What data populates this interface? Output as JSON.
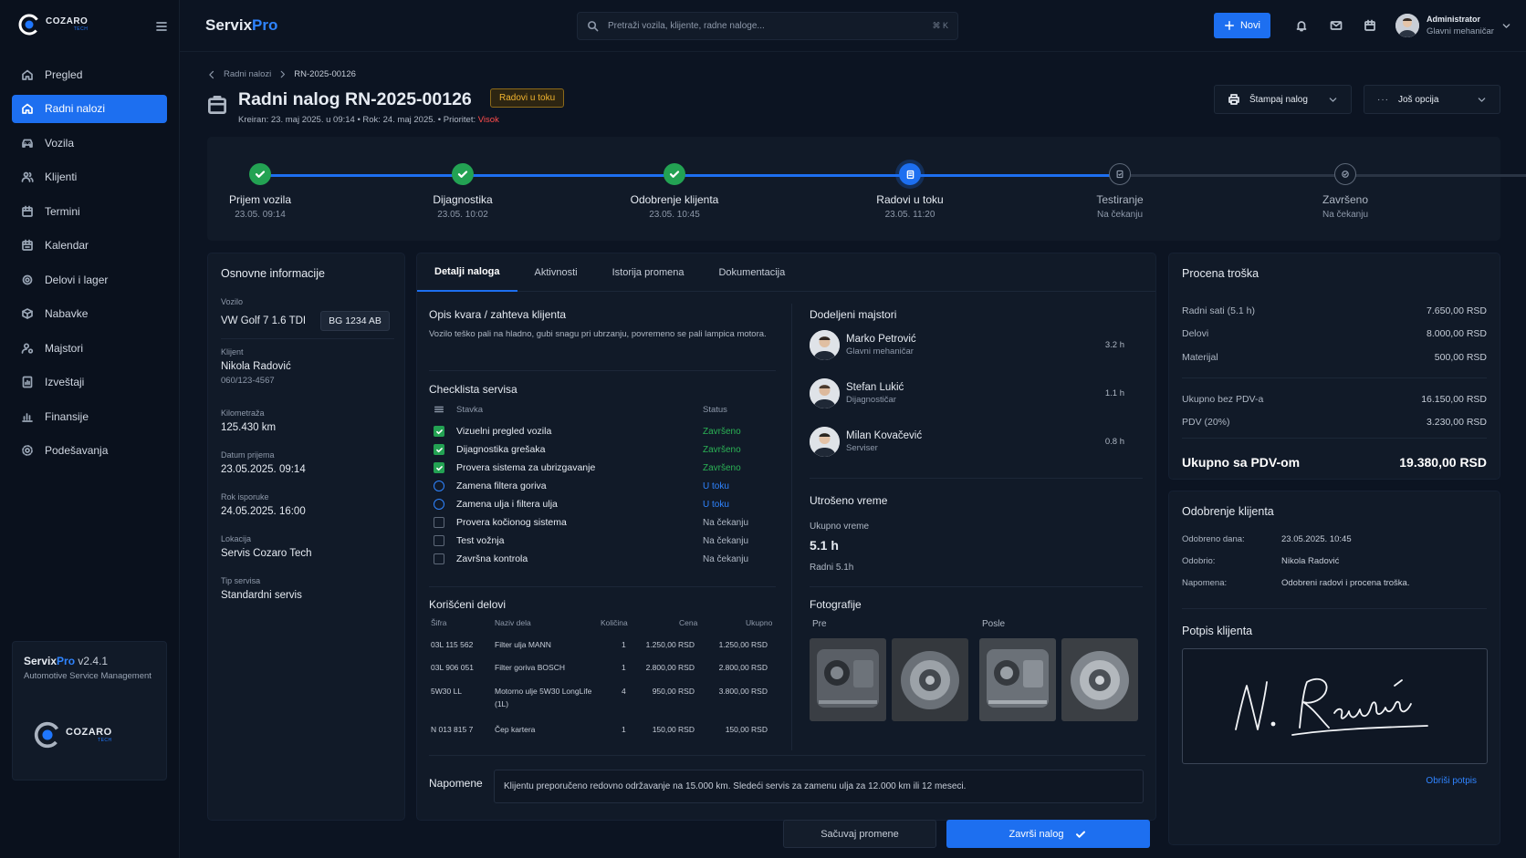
{
  "logo": {
    "name": "COZARO",
    "tag": "TECH"
  },
  "nav": [
    {
      "label": "Pregled",
      "icon": "home-icon"
    },
    {
      "label": "Radni nalozi",
      "icon": "home-icon",
      "active": true
    },
    {
      "label": "Vozila",
      "icon": "car-icon"
    },
    {
      "label": "Klijenti",
      "icon": "users-icon"
    },
    {
      "label": "Termini",
      "icon": "calendar-icon"
    },
    {
      "label": "Kalendar",
      "icon": "calendar-icon"
    },
    {
      "label": "Delovi i lager",
      "icon": "parts-icon"
    },
    {
      "label": "Nabavke",
      "icon": "box-icon"
    },
    {
      "label": "Majstori",
      "icon": "user-gear-icon"
    },
    {
      "label": "Izveštaji",
      "icon": "report-icon"
    },
    {
      "label": "Finansije",
      "icon": "chart-icon"
    },
    {
      "label": "Podešavanja",
      "icon": "gear-icon"
    }
  ],
  "version": {
    "brand_a": "Servix",
    "brand_b": "Pro",
    "version": "v2.4.1",
    "subtitle": "Automotive Service Management"
  },
  "topbar": {
    "brand_a": "Servix",
    "brand_b": "Pro",
    "search_placeholder": "Pretraži vozila, klijente, radne naloge...",
    "search_kbd": "⌘ K",
    "new_label": "Novi",
    "user_name": "Administrator",
    "user_role": "Glavni mehaničar"
  },
  "breadcrumb": {
    "parent": "Radni nalozi",
    "current": "RN-2025-00126"
  },
  "header": {
    "title": "Radni nalog RN-2025-00126",
    "status": "Radovi u toku",
    "meta": "Kreiran: 23. maj 2025. u 09:14 • Rok: 24. maj 2025. • Prioritet:",
    "priority": "Visok",
    "print_label": "Štampaj nalog",
    "more_label": "Još opcija"
  },
  "steps": [
    {
      "name": "Prijem vozila",
      "time": "23.05. 09:14",
      "state": "done"
    },
    {
      "name": "Dijagnostika",
      "time": "23.05. 10:02",
      "state": "done"
    },
    {
      "name": "Odobrenje klijenta",
      "time": "23.05. 10:45",
      "state": "done"
    },
    {
      "name": "Radovi u toku",
      "time": "23.05. 11:20",
      "state": "current"
    },
    {
      "name": "Testiranje",
      "time": "Na čekanju",
      "state": "waiting"
    },
    {
      "name": "Završeno",
      "time": "Na čekanju",
      "state": "waiting"
    }
  ],
  "info": {
    "title": "Osnovne informacije",
    "vehicle_label": "Vozilo",
    "vehicle": "VW Golf 7 1.6 TDI",
    "plate": "BG 1234 AB",
    "client_label": "Klijent",
    "client": "Nikola Radović",
    "phone": "060/123-4567",
    "km_label": "Kilometraža",
    "km": "125.430 km",
    "received_label": "Datum prijema",
    "received": "23.05.2025. 09:14",
    "deadline_label": "Rok isporuke",
    "deadline": "24.05.2025. 16:00",
    "location_label": "Lokacija",
    "location": "Servis Cozaro Tech",
    "type_label": "Tip servisa",
    "type": "Standardni servis"
  },
  "tabs": [
    "Detalji naloga",
    "Aktivnosti",
    "Istorija promena",
    "Dokumentacija"
  ],
  "fault": {
    "title": "Opis kvara / zahteva klijenta",
    "text": "Vozilo teško pali na hladno, gubi snagu pri ubrzanju, povremeno se pali lampica motora."
  },
  "checklist": {
    "title": "Checklista servisa",
    "col_item": "Stavka",
    "col_status": "Status",
    "items": [
      {
        "label": "Vizuelni pregled vozila",
        "status": "Završeno",
        "state": "done"
      },
      {
        "label": "Dijagnostika grešaka",
        "status": "Završeno",
        "state": "done"
      },
      {
        "label": "Provera sistema za ubrizgavanje",
        "status": "Završeno",
        "state": "done"
      },
      {
        "label": "Zamena filtera goriva",
        "status": "U toku",
        "state": "progress"
      },
      {
        "label": "Zamena ulja i filtera ulja",
        "status": "U toku",
        "state": "progress"
      },
      {
        "label": "Provera kočionog sistema",
        "status": "Na čekanju",
        "state": "wait"
      },
      {
        "label": "Test vožnja",
        "status": "Na čekanju",
        "state": "wait"
      },
      {
        "label": "Završna kontrola",
        "status": "Na čekanju",
        "state": "wait"
      }
    ]
  },
  "parts": {
    "title": "Korišćeni delovi",
    "headers": [
      "Šifra",
      "Naziv dela",
      "Količina",
      "Cena",
      "Ukupno"
    ],
    "rows": [
      {
        "code": "03L 115 562",
        "name": "Filter ulja MANN",
        "name2": "",
        "qty": "1",
        "price": "1.250,00 RSD",
        "total": "1.250,00 RSD"
      },
      {
        "code": "03L 906 051",
        "name": "Filter goriva BOSCH",
        "name2": "",
        "qty": "1",
        "price": "2.800,00 RSD",
        "total": "2.800,00 RSD"
      },
      {
        "code": "5W30 LL",
        "name": "Motorno ulje 5W30 LongLife",
        "name2": "(1L)",
        "qty": "4",
        "price": "950,00 RSD",
        "total": "3.800,00 RSD"
      },
      {
        "code": "N 013 815 7",
        "name": "Čep kartera",
        "name2": "",
        "qty": "1",
        "price": "150,00 RSD",
        "total": "150,00 RSD"
      }
    ]
  },
  "mechanics": {
    "title": "Dodeljeni majstori",
    "items": [
      {
        "name": "Marko Petrović",
        "role": "Glavni mehaničar",
        "hours": "3.2 h"
      },
      {
        "name": "Stefan Lukić",
        "role": "Dijagnostičar",
        "hours": "1.1 h"
      },
      {
        "name": "Milan Kovačević",
        "role": "Serviser",
        "hours": "0.8 h"
      }
    ]
  },
  "time": {
    "title": "Utrošeno vreme",
    "label": "Ukupno vreme",
    "value": "5.1 h",
    "sub": "Radni 5.1h"
  },
  "photos": {
    "title": "Fotografije",
    "before": "Pre",
    "after": "Posle"
  },
  "notes": {
    "label": "Napomene",
    "text": "Klijentu preporučeno redovno održavanje na 15.000 km. Sledeći servis za zamenu ulja za 12.000 km ili 12 meseci."
  },
  "actions": {
    "save": "Sačuvaj promene",
    "finish": "Završi nalog"
  },
  "cost": {
    "title": "Procena troška",
    "rows": [
      {
        "label": "Radni sati (5.1 h)",
        "value": "7.650,00 RSD"
      },
      {
        "label": "Delovi",
        "value": "8.000,00 RSD"
      },
      {
        "label": "Materijal",
        "value": "500,00 RSD"
      }
    ],
    "subtotal_label": "Ukupno bez PDV-a",
    "subtotal": "16.150,00 RSD",
    "vat_label": "PDV (20%)",
    "vat": "3.230,00 RSD",
    "total_label": "Ukupno sa PDV-om",
    "total": "19.380,00 RSD"
  },
  "approval": {
    "title": "Odobrenje klijenta",
    "date_label": "Odobreno dana:",
    "date": "23.05.2025. 10:45",
    "by_label": "Odobrio:",
    "by": "Nikola Radović",
    "note_label": "Napomena:",
    "note": "Odobreni radovi i procena troška."
  },
  "signature": {
    "title": "Potpis klijenta",
    "clear": "Obriši potpis"
  },
  "colors": {
    "accent": "#1d6ff0",
    "success": "#23a253",
    "warning": "#f1b42f",
    "danger": "#ff4d4d"
  }
}
